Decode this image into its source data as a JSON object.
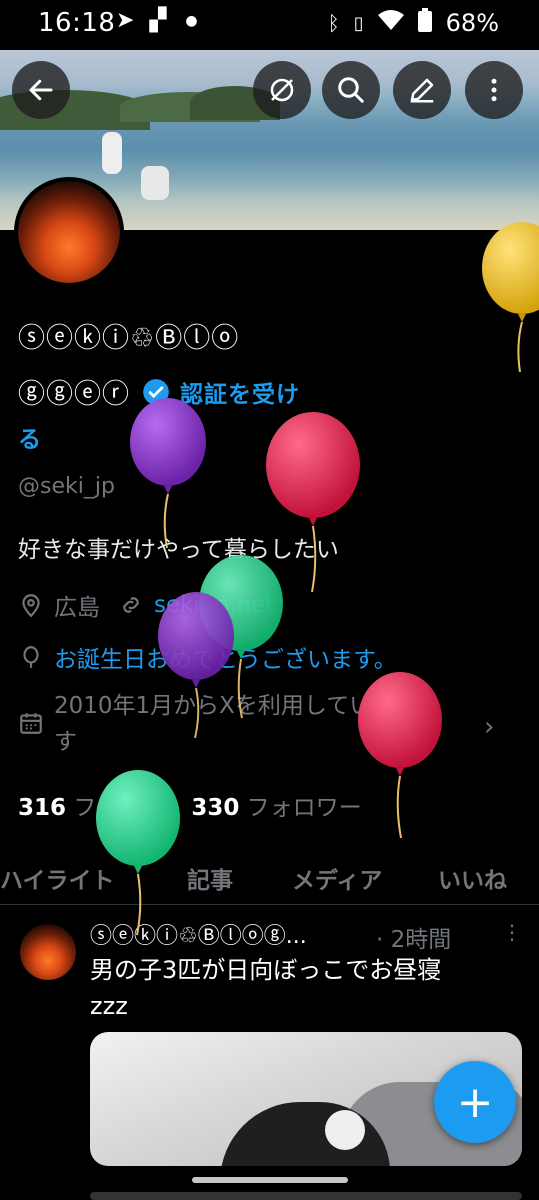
{
  "status_bar": {
    "time": "16:18",
    "battery": "68%",
    "icons": [
      "telegram-icon",
      "signal-icon",
      "dot-icon",
      "bluetooth-icon",
      "vibrate-icon",
      "wifi-icon",
      "battery-icon"
    ]
  },
  "header": {
    "back_icon": "arrow-left-icon",
    "actions": [
      "no-translate-icon",
      "search-icon",
      "edit-icon",
      "more-vertical-icon"
    ]
  },
  "profile": {
    "name_line1": "ⓢⓔⓚⓘ♲Ⓑⓛⓞ",
    "name_line2": "ⓖⓖⓔⓡ",
    "verify_label_1": "認証を受け",
    "verify_label_2": "る",
    "handle": "@seki_jp",
    "bio": "好きな事だけやって暮らしたい",
    "location": "広島",
    "website": "seki-jp.net",
    "birthday": "お誕生日おめでとうございます。",
    "joined_line1": "2010年1月からXを利用していま",
    "joined_line2": "す",
    "following_count": "316",
    "following_label": "フォロー",
    "followers_count": "330",
    "followers_label": "フォロワー"
  },
  "tabs": [
    "ハイライト",
    "記事",
    "メディア",
    "いいね"
  ],
  "post": {
    "author": "ⓢⓔⓚⓘ♲Ⓑⓛⓞⓖ...",
    "time": "· 2時間",
    "text_line1": "男の子3匹が日向ぼっこでお昼寝",
    "text_line2": "zzz"
  },
  "fab_label": "+",
  "colors": {
    "accent": "#1d9bf0",
    "background": "#000000",
    "muted": "#71767b",
    "balloon_purple": "#8a3fd0",
    "balloon_red": "#e0234f",
    "balloon_green": "#2fd08b",
    "balloon_yellow": "#f0c020"
  }
}
